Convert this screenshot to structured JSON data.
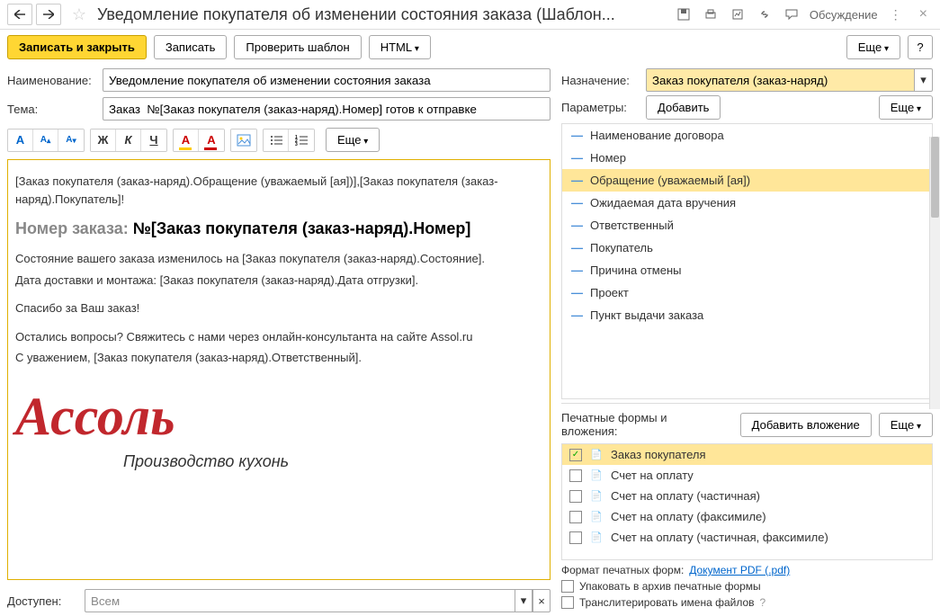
{
  "header": {
    "title": "Уведомление покупателя об изменении состояния заказа (Шаблон...",
    "discuss": "Обсуждение"
  },
  "toolbar": {
    "save_close": "Записать и закрыть",
    "save": "Записать",
    "check_template": "Проверить шаблон",
    "html": "HTML",
    "more": "Еще"
  },
  "fields": {
    "name_label": "Наименование:",
    "name_value": "Уведомление покупателя об изменении состояния заказа",
    "subject_label": "Тема:",
    "subject_value": "Заказ  №[Заказ покупателя (заказ-наряд).Номер] готов к отправке",
    "access_label": "Доступен:",
    "access_value": "Всем"
  },
  "format_more": "Еще",
  "editor": {
    "line1": "[Заказ покупателя (заказ-наряд).Обращение (уважаемый [ая])],[Заказ покупателя (заказ-наряд).Покупатель]!",
    "order_label": "Номер заказа:  ",
    "order_value": "№[Заказ покупателя (заказ-наряд).Номер]",
    "state": "Состояние вашего заказа   изменилось на [Заказ покупателя (заказ-наряд).Состояние].",
    "delivery": "Дата доставки и монтажа: [Заказ покупателя (заказ-наряд).Дата отгрузки].",
    "thanks": "Спасибо за Ваш заказ!",
    "questions": "Остались вопросы? Свяжитесь с нами через онлайн-консультанта на сайте Assol.ru",
    "regards": "С уважением, [Заказ покупателя (заказ-наряд).Ответственный].",
    "logo": "Ассоль",
    "logo_sub": "Производство кухонь"
  },
  "right": {
    "purpose_label": "Назначение:",
    "purpose_value": "Заказ покупателя (заказ-наряд)",
    "params_label": "Параметры:",
    "add_btn": "Добавить",
    "more": "Еще",
    "params": [
      "Наименование договора",
      "Номер",
      "Обращение (уважаемый [ая])",
      "Ожидаемая дата вручения",
      "Ответственный",
      "Покупатель",
      "Причина отмены",
      "Проект",
      "Пункт выдачи заказа"
    ],
    "attach_label": "Печатные формы и вложения:",
    "add_attach": "Добавить вложение",
    "attachments": [
      {
        "name": "Заказ покупателя",
        "checked": true
      },
      {
        "name": "Счет на оплату",
        "checked": false
      },
      {
        "name": "Счет на оплату (частичная)",
        "checked": false
      },
      {
        "name": "Счет на оплату (факсимиле)",
        "checked": false
      },
      {
        "name": "Счет на оплату (частичная, факсимиле)",
        "checked": false
      }
    ],
    "format_label": "Формат печатных форм:",
    "format_link": "Документ PDF (.pdf)",
    "archive": "Упаковать в архив печатные формы",
    "translit": "Транслитерировать имена файлов"
  }
}
